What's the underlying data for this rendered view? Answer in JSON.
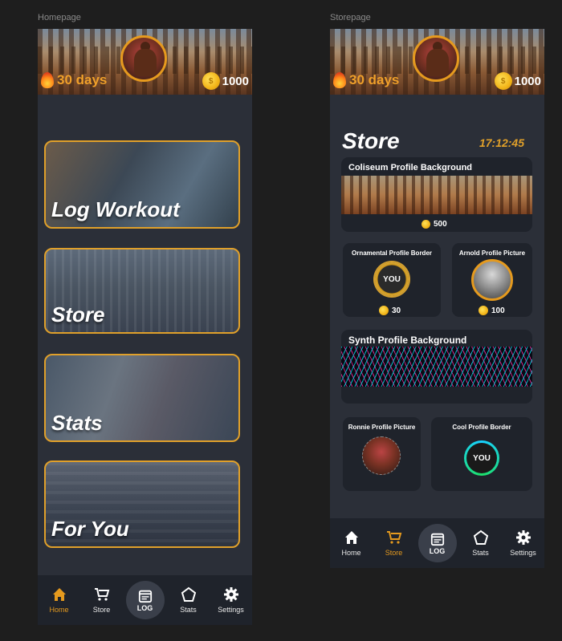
{
  "frames": {
    "home_label": "Homepage",
    "store_label": "Storepage"
  },
  "header": {
    "streak": "30 days",
    "coins": "1000"
  },
  "home": {
    "tiles": [
      {
        "label": "Log Workout"
      },
      {
        "label": "Store"
      },
      {
        "label": "Stats"
      },
      {
        "label": "For You"
      }
    ]
  },
  "store": {
    "title": "Store",
    "timer": "17:12:45",
    "items": [
      {
        "title": "Coliseum Profile Background",
        "price": "500"
      },
      {
        "title": "Ornamental Profile Border",
        "price": "30",
        "badge": "YOU"
      },
      {
        "title": "Arnold Profile Picture",
        "price": "100"
      },
      {
        "title": "Synth Profile Background"
      },
      {
        "title": "Ronnie Profile Picture"
      },
      {
        "title": "Cool Profile Border",
        "badge": "YOU"
      }
    ]
  },
  "nav": {
    "home": "Home",
    "store": "Store",
    "log": "LOG",
    "stats": "Stats",
    "settings": "Settings"
  },
  "colors": {
    "accent": "#e59a1e",
    "background": "#2b2f38",
    "card": "#1f232b"
  }
}
